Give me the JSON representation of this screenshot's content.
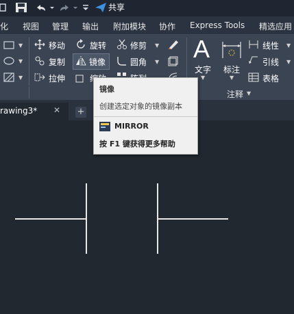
{
  "quick_access": {
    "share_label": "共享"
  },
  "ribbon_tabs": [
    "化",
    "视图",
    "管理",
    "输出",
    "附加模块",
    "协作",
    "Express Tools",
    "精选应用"
  ],
  "modify_panel": {
    "move": "移动",
    "rotate": "旋转",
    "trim": "修剪",
    "copy": "复制",
    "mirror": "镜像",
    "fillet": "圆角",
    "stretch": "拉伸",
    "scale": "缩放",
    "array": "阵列"
  },
  "annotation_panel": {
    "text": "文字",
    "dimension": "标注",
    "linetype": "线性",
    "leader": "引线",
    "table": "表格",
    "panel_label": "注释"
  },
  "file_tabs": {
    "active": "rawing3*",
    "close": "✕",
    "add": "+"
  },
  "tooltip": {
    "title": "镜像",
    "description": "创建选定对象的镜像副本",
    "command": "MIRROR",
    "help": "按 F1 键获得更多帮助"
  },
  "colors": {
    "background": "#212830",
    "ribbon": "#3a4453",
    "tooltip_bg": "#f0f0f0",
    "share_blue": "#3d8fe0"
  }
}
